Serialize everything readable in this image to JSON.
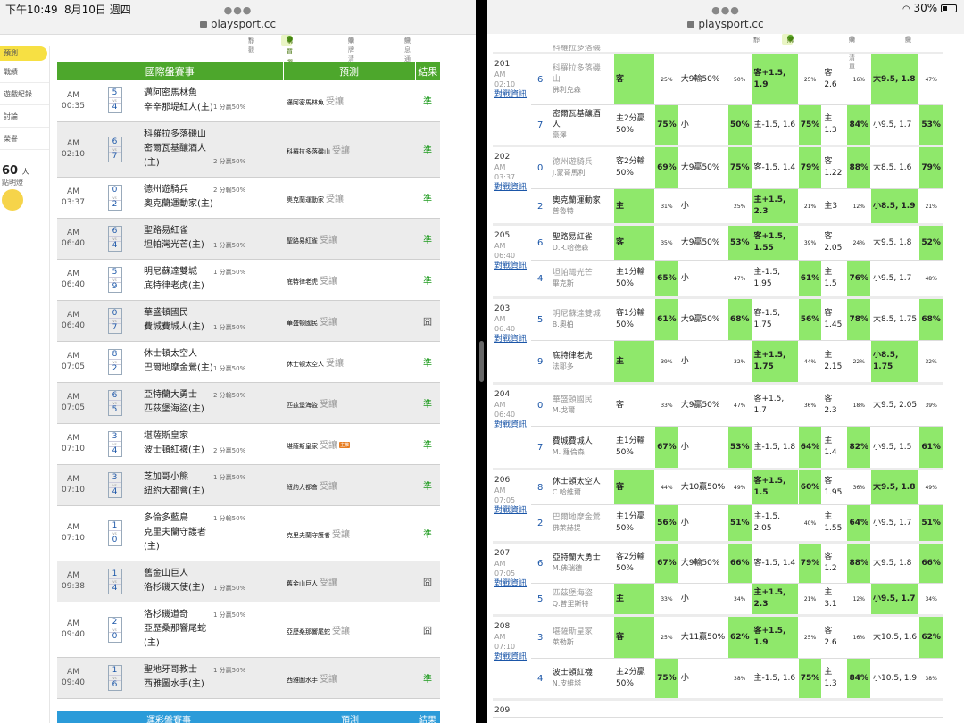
{
  "status": {
    "time": "下午10:49",
    "date": "8月10日 週四",
    "battery": "30%"
  },
  "url": "playsport.cc",
  "subnav": [
    "靜觀",
    "購買選單",
    "購牌清單",
    "訊息通知"
  ],
  "side": {
    "tab": "預測",
    "items": [
      "戰績",
      "遊戲紀錄",
      "討論",
      "榮譽"
    ],
    "count": "60",
    "unit": "人",
    "note": "點明燈"
  },
  "left": {
    "headers": [
      "國際盤賽事",
      "預測",
      "結果"
    ],
    "bottom_headers": [
      "運彩盤賽事",
      "預測",
      "結果"
    ],
    "rows": [
      {
        "ampm": "AM",
        "time": "00:35",
        "s1": "5",
        "s2": "4",
        "t1": "邁阿密馬林魚",
        "t2": "辛辛那堤紅人(主)",
        "hint": "1 分贏50%",
        "hint_row": 2,
        "pick": "邁阿密馬林魚",
        "pick_tag": "受讓",
        "res": "準",
        "alt": false,
        "h": 46
      },
      {
        "ampm": "AM",
        "time": "02:10",
        "s1": "6",
        "s2": "7",
        "t1": "科羅拉多落磯山",
        "t2": "密爾瓦基釀酒人",
        "t3": "(主)",
        "hint": "2 分贏50%",
        "hint_row": 3,
        "pick": "科羅拉多落磯山",
        "pick_tag": "受讓",
        "res": "準",
        "alt": true,
        "h": 62
      },
      {
        "ampm": "AM",
        "time": "03:37",
        "s1": "0",
        "s2": "2",
        "t1": "德州遊騎兵",
        "t2": "奧克蘭運動家(主)",
        "hint": "2 分輸50%",
        "hint_row": 1,
        "pick": "奧克蘭運動家",
        "pick_tag": "受讓",
        "res": "準",
        "alt": false,
        "h": 46
      },
      {
        "ampm": "AM",
        "time": "06:40",
        "s1": "6",
        "s2": "4",
        "t1": "聖路易紅雀",
        "t2": "坦帕灣光芒(主)",
        "hint": "1 分贏50%",
        "hint_row": 2,
        "pick": "聖路易紅雀",
        "pick_tag": "受讓",
        "res": "準",
        "alt": true,
        "h": 46
      },
      {
        "ampm": "AM",
        "time": "06:40",
        "s1": "5",
        "s2": "9",
        "t1": "明尼蘇達雙城",
        "t2": "底特律老虎(主)",
        "hint": "1 分贏50%",
        "hint_row": 1,
        "pick": "底特律老虎",
        "pick_tag": "受讓",
        "res": "準",
        "alt": false,
        "h": 46
      },
      {
        "ampm": "AM",
        "time": "06:40",
        "s1": "0",
        "s2": "7",
        "t1": "華盛頓國民",
        "t2": "費城費城人(主)",
        "hint": "1 分贏50%",
        "hint_row": 2,
        "pick": "華盛頓國民",
        "pick_tag": "受讓",
        "res": "囧",
        "alt": true,
        "h": 46
      },
      {
        "ampm": "AM",
        "time": "07:05",
        "s1": "8",
        "s2": "2",
        "t1": "休士頓太空人",
        "t2": "巴爾地摩金鶯(主)",
        "hint": "1 分贏50%",
        "hint_row": 2,
        "pick": "休士頓太空人",
        "pick_tag": "受讓",
        "res": "準",
        "alt": false,
        "h": 46
      },
      {
        "ampm": "AM",
        "time": "07:05",
        "s1": "6",
        "s2": "5",
        "t1": "亞特蘭大勇士",
        "t2": "匹茲堡海盜(主)",
        "hint": "2 分輸50%",
        "hint_row": 1,
        "pick": "匹茲堡海盜",
        "pick_tag": "受讓",
        "res": "準",
        "alt": true,
        "h": 46
      },
      {
        "ampm": "AM",
        "time": "07:10",
        "s1": "3",
        "s2": "4",
        "t1": "堪薩斯皇家",
        "t2": "波士頓紅襪(主)",
        "hint": "2 分贏50%",
        "hint_row": 2,
        "pick": "堪薩斯皇家",
        "pick_tag": "受讓",
        "badge": "主推",
        "res": "準",
        "alt": false,
        "h": 46
      },
      {
        "ampm": "AM",
        "time": "07:10",
        "s1": "3",
        "s2": "4",
        "t1": "芝加哥小熊",
        "t2": "紐約大都會(主)",
        "hint": "1 分贏50%",
        "hint_row": 1,
        "pick": "紐約大都會",
        "pick_tag": "受讓",
        "res": "準",
        "alt": true,
        "h": 46
      },
      {
        "ampm": "AM",
        "time": "07:10",
        "s1": "1",
        "s2": "0",
        "t1": "多倫多藍鳥",
        "t2": "克里夫蘭守護者",
        "t3": "(主)",
        "hint": "1 分輸50%",
        "hint_row": 1,
        "pick": "克里夫蘭守護者",
        "pick_tag": "受讓",
        "res": "準",
        "alt": false,
        "h": 62
      },
      {
        "ampm": "AM",
        "time": "09:38",
        "s1": "1",
        "s2": "4",
        "t1": "舊金山巨人",
        "t2": "洛杉磯天使(主)",
        "hint": "1 分贏50%",
        "hint_row": 2,
        "pick": "舊金山巨人",
        "pick_tag": "受讓",
        "res": "囧",
        "alt": true,
        "h": 46
      },
      {
        "ampm": "AM",
        "time": "09:40",
        "s1": "2",
        "s2": "0",
        "t1": "洛杉磯道奇",
        "t2": "亞歷桑那響尾蛇",
        "t3": "(主)",
        "hint": "1 分贏50%",
        "hint_row": 1,
        "pick": "亞歷桑那響尾蛇",
        "pick_tag": "受讓",
        "res": "囧",
        "alt": false,
        "h": 62
      },
      {
        "ampm": "AM",
        "time": "09:40",
        "s1": "1",
        "s2": "6",
        "t1": "聖地牙哥教士",
        "t2": "西雅圖水手(主)",
        "hint": "1 分贏50%",
        "hint_row": 1,
        "pick": "西雅圖水手",
        "pick_tag": "受讓",
        "res": "準",
        "alt": true,
        "h": 46
      }
    ]
  },
  "right": {
    "top_partial": {
      "t1": "科羅拉多落磯",
      "t2": "山"
    },
    "games": [
      {
        "id": "201",
        "ampm": "AM",
        "time": "02:10",
        "link": "對戰資訊",
        "s1": "6",
        "s2": "7",
        "a1": "科羅拉多落磯",
        "a1b": "山",
        "a1p": "佛利克森",
        "a1dim": true,
        "a2": "密爾瓦基釀酒",
        "a2b": "人",
        "a2p": "豪澤",
        "a2dim": false,
        "r1": [
          "客",
          "25%",
          "大9輸50%",
          "50%",
          "客+1.5, 1.9",
          "25%",
          "客2.6",
          "16%",
          "大9.5, 1.8",
          "47%"
        ],
        "g1": [
          1,
          0,
          0,
          0,
          1,
          0,
          0,
          0,
          1
        ],
        "r2": [
          "主2分贏50%",
          "75%",
          "小",
          "50%",
          "主-1.5, 1.6",
          "75%",
          "主1.3",
          "84%",
          "小9.5, 1.7",
          "53%"
        ],
        "g2": [
          0,
          1,
          0,
          1,
          0,
          1,
          0,
          1,
          0,
          1
        ],
        "h": [
          58,
          46
        ]
      },
      {
        "id": "202",
        "ampm": "AM",
        "time": "03:37",
        "link": "對戰資訊",
        "s1": "0",
        "s2": "2",
        "a1": "德州遊騎兵",
        "a1p": "J.蒙哥馬利",
        "a1dim": true,
        "a2": "奧克蘭運動家",
        "a2p": "普魯特",
        "a2dim": false,
        "r1": [
          "客2分輸50%",
          "69%",
          "大9贏50%",
          "75%",
          "客-1.5, 1.4",
          "79%",
          "客 1.22",
          "88%",
          "大8.5, 1.6",
          "79%"
        ],
        "g1": [
          0,
          1,
          0,
          1,
          0,
          1,
          0,
          1,
          0,
          1
        ],
        "r2": [
          "主",
          "31%",
          "小",
          "25%",
          "主+1.5, 2.3",
          "21%",
          "主3",
          "12%",
          "小8.5, 1.9",
          "21%"
        ],
        "g2": [
          1,
          0,
          0,
          0,
          1,
          0,
          0,
          0,
          1
        ],
        "h": [
          48,
          40
        ]
      },
      {
        "id": "205",
        "ampm": "AM",
        "time": "06:40",
        "link": "對戰資訊",
        "s1": "6",
        "s2": "4",
        "a1": "聖路易紅雀",
        "a1p": "D.R.哈德森",
        "a1dim": false,
        "a2": "坦帕灣光芒",
        "a2p": "畢克斯",
        "a2dim": true,
        "r1": [
          "客",
          "35%",
          "大9贏50%",
          "53%",
          "客+1.5, 1.55",
          "39%",
          "客 2.05",
          "24%",
          "大9.5, 1.8",
          "52%"
        ],
        "g1": [
          1,
          0,
          0,
          1,
          1,
          0,
          0,
          0,
          0,
          1
        ],
        "r2": [
          "主1分輸50%",
          "65%",
          "小",
          "47%",
          "主-1.5, 1.95",
          "61%",
          "主1.5",
          "76%",
          "小9.5, 1.7",
          "48%"
        ],
        "g2": [
          0,
          1,
          0,
          0,
          0,
          1,
          0,
          1,
          0,
          0
        ],
        "h": [
          40,
          42
        ]
      },
      {
        "id": "203",
        "ampm": "AM",
        "time": "06:40",
        "link": "對戰資訊",
        "s1": "5",
        "s2": "9",
        "a1": "明尼蘇達雙城",
        "a1p": "B.奧柏",
        "a1dim": true,
        "a2": "底特律老虎",
        "a2p": "法耶多",
        "a2dim": false,
        "r1": [
          "客1分輸50%",
          "61%",
          "大9贏50%",
          "68%",
          "客-1.5, 1.75",
          "56%",
          "客 1.45",
          "78%",
          "大8.5, 1.75",
          "68%"
        ],
        "g1": [
          0,
          1,
          0,
          1,
          0,
          1,
          0,
          1,
          0,
          1
        ],
        "r2": [
          "主",
          "39%",
          "小",
          "32%",
          "主+1.5, 1.75",
          "44%",
          "主 2.15",
          "22%",
          "小8.5, 1.75",
          "32%"
        ],
        "g2": [
          1,
          0,
          0,
          0,
          1,
          0,
          0,
          0,
          1
        ],
        "h": [
          48,
          48
        ]
      },
      {
        "id": "204",
        "ampm": "AM",
        "time": "06:40",
        "link": "對戰資訊",
        "s1": "0",
        "s2": "7",
        "a1": "華盛頓國民",
        "a1p": "M.戈爾",
        "a1dim": true,
        "a2": "費城費城人",
        "a2p": "M. 羅倫森",
        "a2dim": false,
        "r1": [
          "客",
          "33%",
          "大9贏50%",
          "47%",
          "客+1.5, 1.7",
          "36%",
          "客2.3",
          "18%",
          "大9.5, 2.05",
          "39%"
        ],
        "g1": [
          0,
          0,
          0,
          0,
          0,
          0,
          0,
          0,
          0,
          0
        ],
        "r2": [
          "主1分輸50%",
          "67%",
          "小",
          "53%",
          "主-1.5, 1.8",
          "64%",
          "主1.4",
          "82%",
          "小9.5, 1.5",
          "61%"
        ],
        "g2": [
          0,
          1,
          0,
          1,
          0,
          1,
          0,
          1,
          0,
          1
        ],
        "h": [
          48,
          48
        ]
      },
      {
        "id": "206",
        "ampm": "AM",
        "time": "07:05",
        "link": "對戰資訊",
        "s1": "8",
        "s2": "2",
        "a1": "休士頓太空人",
        "a1p": "C.哈維爾",
        "a1dim": false,
        "a2": "巴爾地摩金鶯",
        "a2p": "佛萊赫提",
        "a2dim": true,
        "r1": [
          "客",
          "44%",
          "大10贏50%",
          "49%",
          "客+1.5, 1.5",
          "60%",
          "客 1.95",
          "36%",
          "大9.5, 1.8",
          "49%"
        ],
        "g1": [
          1,
          0,
          0,
          0,
          1,
          1,
          0,
          0,
          1
        ],
        "r2": [
          "主1分贏50%",
          "56%",
          "小",
          "51%",
          "主-1.5, 2.05",
          "40%",
          "主 1.55",
          "64%",
          "小9.5, 1.7",
          "51%"
        ],
        "g2": [
          0,
          1,
          0,
          1,
          0,
          0,
          0,
          1,
          0,
          1
        ],
        "h": [
          40,
          42
        ]
      },
      {
        "id": "207",
        "ampm": "AM",
        "time": "07:05",
        "link": "對戰資訊",
        "s1": "6",
        "s2": "5",
        "a1": "亞特蘭大勇士",
        "a1p": "M.佛瑞德",
        "a1dim": false,
        "a2": "匹茲堡海盜",
        "a2p": "Q.普里斯特",
        "a2dim": true,
        "r1": [
          "客2分輸50%",
          "67%",
          "大9輸50%",
          "66%",
          "客-1.5, 1.4",
          "79%",
          "客1.2",
          "88%",
          "大9.5, 1.8",
          "66%"
        ],
        "g1": [
          0,
          1,
          0,
          1,
          0,
          1,
          0,
          1,
          0,
          1
        ],
        "r2": [
          "主",
          "33%",
          "小",
          "34%",
          "主+1.5, 2.3",
          "21%",
          "主3.1",
          "12%",
          "小9.5, 1.7",
          "34%"
        ],
        "g2": [
          1,
          0,
          0,
          0,
          1,
          0,
          0,
          0,
          1
        ],
        "h": [
          46,
          36
        ]
      },
      {
        "id": "208",
        "ampm": "AM",
        "time": "07:10",
        "link": "對戰資訊",
        "s1": "3",
        "s2": "4",
        "a1": "堪薩斯皇家",
        "a1p": "萊勒斯",
        "a1dim": true,
        "a2": "波士頓紅襪",
        "a2p": "N.皮維塔",
        "a2dim": false,
        "r1": [
          "客",
          "25%",
          "大11贏50%",
          "62%",
          "客+1.5, 1.9",
          "25%",
          "客2.6",
          "16%",
          "大10.5, 1.6",
          "62%"
        ],
        "g1": [
          1,
          0,
          0,
          1,
          1,
          0,
          0,
          0,
          0,
          1
        ],
        "r2": [
          "主2分贏50%",
          "75%",
          "小",
          "38%",
          "主-1.5, 1.6",
          "75%",
          "主1.3",
          "84%",
          "小10.5, 1.9",
          "38%"
        ],
        "g2": [
          0,
          1,
          0,
          0,
          0,
          1,
          0,
          1,
          0,
          0
        ],
        "h": [
          48,
          46
        ]
      }
    ],
    "next": {
      "id": "209"
    }
  }
}
